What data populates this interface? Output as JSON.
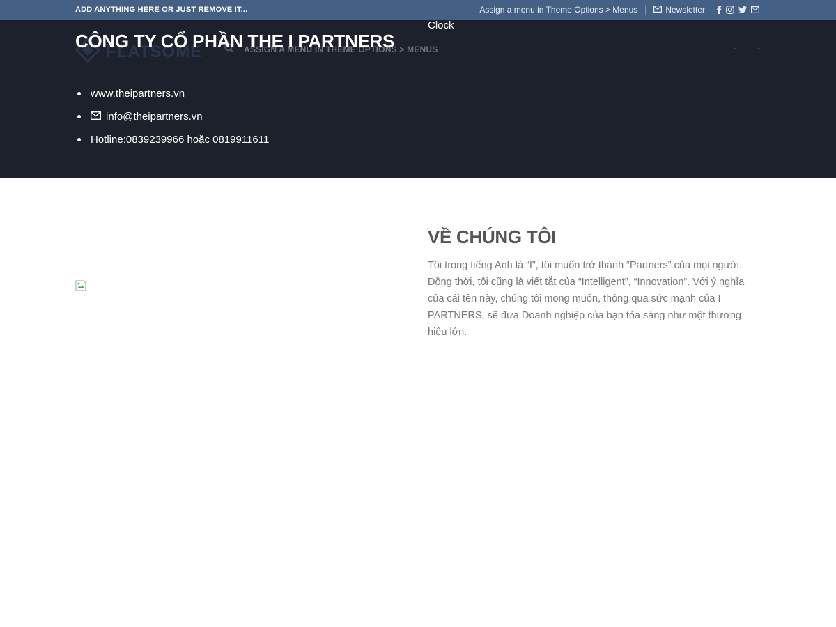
{
  "topbar": {
    "left_text": "ADD ANYTHING HERE OR JUST REMOVE IT...",
    "menu_hint": "Assign a menu in Theme Options > Menus",
    "newsletter_label": "Newsletter",
    "background": "#446084",
    "social_icons": [
      "facebook-icon",
      "instagram-icon",
      "twitter-icon",
      "email-icon"
    ]
  },
  "header": {
    "background": "#1d212b",
    "ghost_logo_text": "FLATSOME",
    "ghost_menu_text": "ASSIGN A MENU IN THEME OPTIONS > MENUS",
    "ghost_dash": "-",
    "company_name": "CÔNG TY CỔ PHẦN THE I PARTNERS",
    "clock_label": "Clock",
    "contacts": {
      "website": "www.theipartners.vn",
      "email": "info@theipartners.vn",
      "hotline": "Hotline:0839239966 hoặc 0819911611"
    }
  },
  "about": {
    "heading": "VỀ CHÚNG TÔI",
    "paragraph": "Tôi trong tiếng Anh là “I”, tôi muốn trở thành “Partners” của mọi người. Đồng thời, tôi cũng là viết tắt của “Intelligent”, “Innovation”. Với ý nghĩa của cái tên này, chúng tôi mong muốn, thông qua sức mạnh của I PARTNERS, sẽ đưa Doanh nghiệp của bạn tỏa sáng như một thương hiệu lớn."
  }
}
